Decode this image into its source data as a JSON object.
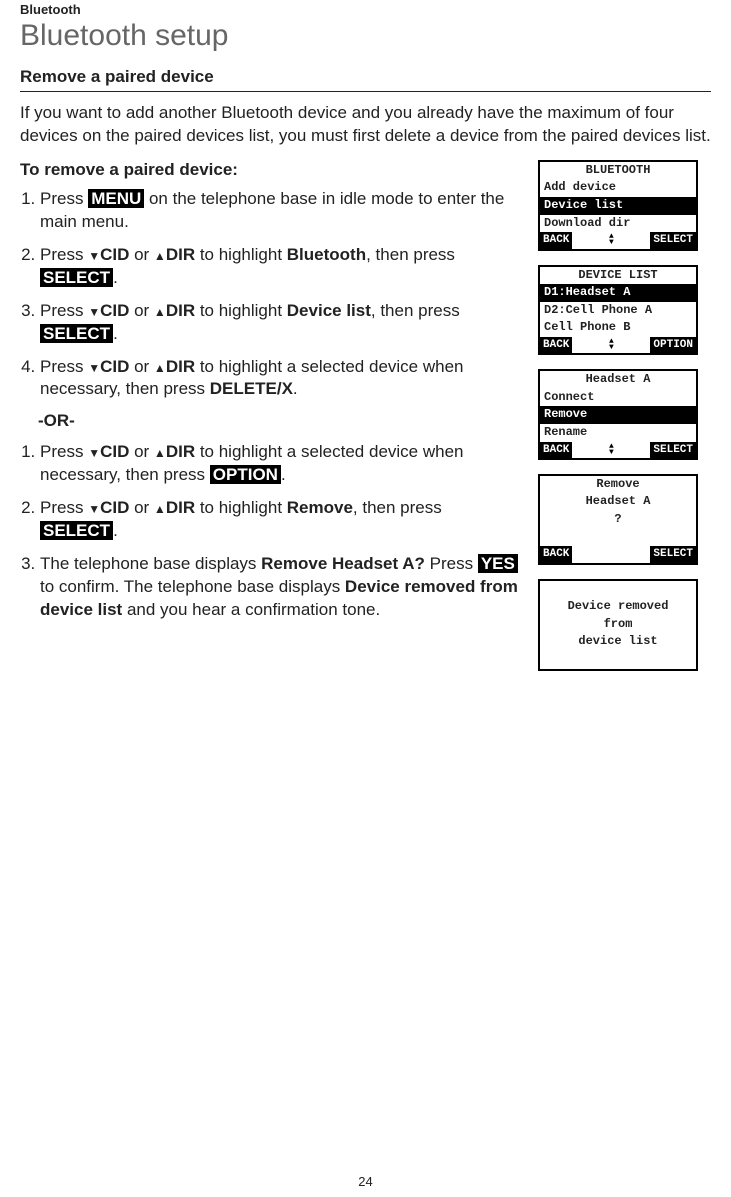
{
  "header": {
    "breadcrumb": "Bluetooth",
    "title": "Bluetooth setup"
  },
  "section": {
    "heading": "Remove a paired device",
    "intro": "If you want to add another Bluetooth device and you already have the maximum of four devices on the paired devices list, you must first delete a device from the paired devices list.",
    "subheading": "To remove a paired device:"
  },
  "keys": {
    "menu": "MENU",
    "select": "SELECT",
    "option": "OPTION",
    "yes": "YES",
    "cid": "CID",
    "dir": "DIR"
  },
  "steps1": {
    "s1a": "Press ",
    "s1b": " on the telephone base in idle mode to enter the main menu.",
    "s2a": "Press ",
    "s2b": " or ",
    "s2c": " to highlight ",
    "s2d": "Bluetooth",
    "s2e": ", then press ",
    "s2f": ".",
    "s3a": "Press ",
    "s3b": " or ",
    "s3c": " to highlight ",
    "s3d": "Device list",
    "s3e": ", then press ",
    "s3f": ".",
    "s4a": "Press ",
    "s4b": " or ",
    "s4c": " to highlight a selected device when necessary, then press ",
    "s4d": "DELETE/X",
    "s4e": "."
  },
  "or_label": "-OR-",
  "steps2": {
    "s1a": "Press ",
    "s1b": " or ",
    "s1c": " to highlight a selected device when necessary, then press ",
    "s1d": ".",
    "s2a": "Press ",
    "s2b": " or ",
    "s2c": " to highlight ",
    "s2d": "Remove",
    "s2e": ", then press ",
    "s2f": ".",
    "s3a": "The telephone base displays ",
    "s3b": "Remove Headset A?",
    "s3c": " Press ",
    "s3d": " to confirm. The telephone base displays ",
    "s3e": "Device removed from device list",
    "s3f": " and you hear a confirmation tone."
  },
  "screens": {
    "s1": {
      "title": "BLUETOOTH",
      "r1": "Add device",
      "r2": "Device list",
      "r3": "Download dir",
      "back": "BACK",
      "right": "SELECT"
    },
    "s2": {
      "title": "DEVICE LIST",
      "r1": "D1:Headset A",
      "r2": "D2:Cell Phone A",
      "r3": "Cell Phone B",
      "back": "BACK",
      "right": "OPTION"
    },
    "s3": {
      "title": "Headset A",
      "r1": "Connect",
      "r2": "Remove",
      "r3": "Rename",
      "back": "BACK",
      "right": "SELECT"
    },
    "s4": {
      "r1": "Remove",
      "r2": "Headset A",
      "r3": "?",
      "back": "BACK",
      "right": "SELECT"
    },
    "s5": {
      "r1": "Device removed",
      "r2": "from",
      "r3": "device list"
    }
  },
  "page_number": "24"
}
